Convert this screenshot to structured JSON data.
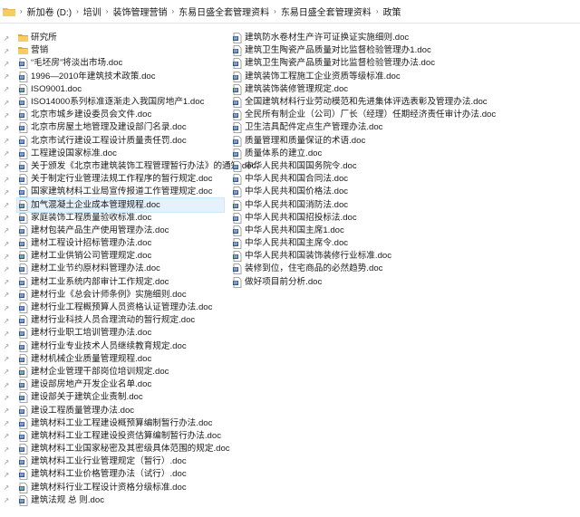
{
  "address": {
    "crumbs": [
      "新加卷 (D:)",
      "培训",
      "装饰管理营销",
      "东易日盛全套管理资料",
      "东易日盛全套管理资料",
      "政策"
    ]
  },
  "files": {
    "column1": [
      {
        "name": "研究所",
        "type": "folder"
      },
      {
        "name": "营销",
        "type": "folder"
      },
      {
        "name": "“毛坯房”将淡出市场.doc",
        "type": "doc"
      },
      {
        "name": "1996—2010年建筑技术政策.doc",
        "type": "doc"
      },
      {
        "name": "ISO9001.doc",
        "type": "doc"
      },
      {
        "name": "ISO14000系列标准逐渐走入我国房地产1.doc",
        "type": "doc"
      },
      {
        "name": "北京市城乡建设委员会文件.doc",
        "type": "doc"
      },
      {
        "name": "北京市房屋土地管理及建设部门名录.doc",
        "type": "doc"
      },
      {
        "name": "北京市试行建设工程设计质量责任罚.doc",
        "type": "doc"
      },
      {
        "name": "工程建设国家标准.doc",
        "type": "doc"
      },
      {
        "name": "关于颁发《北京市建筑装饰工程管理暂行办法》的通知.doc",
        "type": "doc"
      },
      {
        "name": "关于制定行业管理法规工作程序的暂行规定.doc",
        "type": "doc"
      },
      {
        "name": "国家建筑材料工业局宣传报道工作管理规定.doc",
        "type": "doc"
      },
      {
        "name": "加气混凝土企业成本管理规程.doc",
        "type": "doc",
        "selected": true
      },
      {
        "name": "家庭装饰工程质量验收标准.doc",
        "type": "doc"
      },
      {
        "name": "建材包装产品生产使用管理办法.doc",
        "type": "doc"
      },
      {
        "name": "建材工程设计招标管理办法.doc",
        "type": "doc"
      },
      {
        "name": "建材工业供销公司管理规定.doc",
        "type": "doc"
      },
      {
        "name": "建材工业节约原材料管理办法.doc",
        "type": "doc"
      },
      {
        "name": "建材工业系统内部审计工作规定.doc",
        "type": "doc"
      },
      {
        "name": "建材行业《总会计师条例》实施细则.doc",
        "type": "doc"
      },
      {
        "name": "建材行业工程概预算人员资格认证管理办法.doc",
        "type": "doc"
      },
      {
        "name": "建材行业科技人员合理流动的暂行规定.doc",
        "type": "doc"
      },
      {
        "name": "建材行业职工培训管理办法.doc",
        "type": "doc"
      },
      {
        "name": "建材行业专业技术人员继续教育规定.doc",
        "type": "doc"
      },
      {
        "name": "建材机械企业质量管理规程.doc",
        "type": "doc"
      },
      {
        "name": "建材企业管理干部岗位培训规定.doc",
        "type": "doc"
      },
      {
        "name": "建设部房地产开发企业名单.doc",
        "type": "doc"
      },
      {
        "name": "建设部关于建筑企业责制.doc",
        "type": "doc"
      },
      {
        "name": "建设工程质量管理办法.doc",
        "type": "doc"
      },
      {
        "name": "建筑材料工业工程建设概预算编制暂行办法.doc",
        "type": "doc"
      },
      {
        "name": "建筑材料工业工程建设投资估算编制暂行办法.doc",
        "type": "doc"
      },
      {
        "name": "建筑材料工业国家秘密及其密级具体范围的规定.doc",
        "type": "doc"
      },
      {
        "name": "建筑材料工业行业管理规定（暂行）.doc",
        "type": "doc"
      },
      {
        "name": "建筑材料工业价格管理办法（试行）.doc",
        "type": "doc"
      },
      {
        "name": "建筑材料行业工程设计资格分级标准.doc",
        "type": "doc"
      },
      {
        "name": "建筑法规 总 则.doc",
        "type": "doc"
      }
    ],
    "column2": [
      {
        "name": "建筑防水卷材生产许可证换证实施细则.doc",
        "type": "doc"
      },
      {
        "name": "建筑卫生陶瓷产品质量对比监督检验管理办1.doc",
        "type": "doc"
      },
      {
        "name": "建筑卫生陶瓷产品质量对比监督检验管理办法.doc",
        "type": "doc"
      },
      {
        "name": "建筑装饰工程施工企业资质等级标准.doc",
        "type": "doc"
      },
      {
        "name": "建筑装饰装修管理规定.doc",
        "type": "doc"
      },
      {
        "name": "全国建筑材料行业劳动模范和先进集体评选表彰及管理办法.doc",
        "type": "doc"
      },
      {
        "name": "全民所有制企业（公司）厂长（经理）任期经济责任审计办法.doc",
        "type": "doc"
      },
      {
        "name": "卫生洁具配件定点生产管理办法.doc",
        "type": "doc"
      },
      {
        "name": "质量管理和质量保证的术语.doc",
        "type": "doc"
      },
      {
        "name": "质量体系的建立.doc",
        "type": "doc"
      },
      {
        "name": "中华人民共和国国务院令.doc",
        "type": "doc"
      },
      {
        "name": "中华人民共和国合同法.doc",
        "type": "doc"
      },
      {
        "name": "中华人民共和国价格法.doc",
        "type": "doc"
      },
      {
        "name": "中华人民共和国消防法.doc",
        "type": "doc"
      },
      {
        "name": "中华人民共和国招投标法.doc",
        "type": "doc"
      },
      {
        "name": "中华人民共和国主席1.doc",
        "type": "doc"
      },
      {
        "name": "中华人民共和国主席令.doc",
        "type": "doc"
      },
      {
        "name": "中华人民共和国装饰装修行业标准.doc",
        "type": "doc"
      },
      {
        "name": "装修到位，住宅商品的必然趋势.doc",
        "type": "doc"
      },
      {
        "name": "做好项目前分析.doc",
        "type": "doc"
      }
    ]
  },
  "colors": {
    "selection": "#e5f1fb",
    "folder": "#e8b84a",
    "doc_icon": "#2b5797"
  }
}
